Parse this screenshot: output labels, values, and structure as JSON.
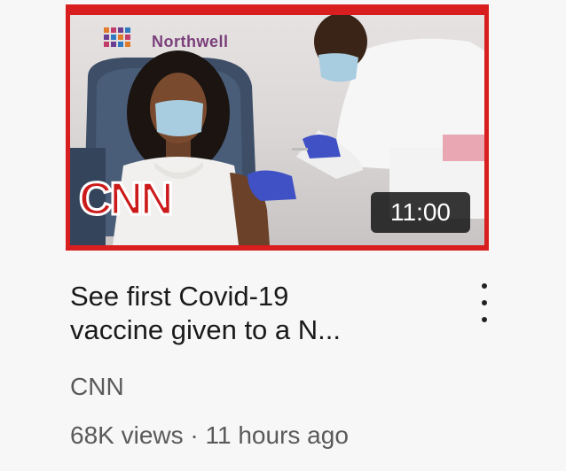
{
  "video": {
    "brand_text": "Northwell",
    "logo_text": "CNN",
    "duration": "11:00",
    "title_line1": "See first Covid-19",
    "title_line2": "vaccine given to a N...",
    "channel": "CNN",
    "views": "68K views",
    "separator": "·",
    "age": "11 hours ago"
  },
  "menu": {
    "icon": "more-vertical-icon"
  },
  "colors": {
    "thumbnail_border": "#d81e1e",
    "cnn_red": "#cc1a1a",
    "title_text": "#1a1a1a",
    "meta_text": "#5a5a5a",
    "duration_badge": "#141414"
  }
}
